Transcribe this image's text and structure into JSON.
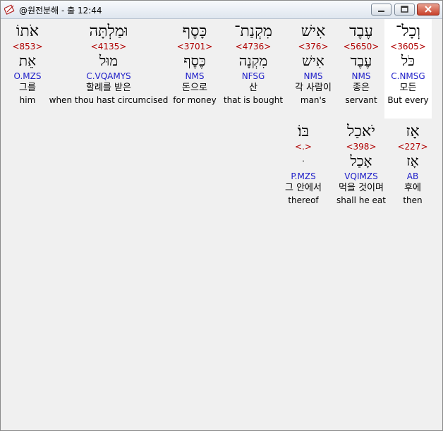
{
  "window": {
    "title": "@원전분해 - 출 12:44",
    "minimize_icon": "minimize-icon",
    "maximize_icon": "maximize-icon",
    "close_icon": "close-icon",
    "app_icon": "app-icon"
  },
  "row1": [
    {
      "hebrew": "וְכָל־",
      "strong": "<3605>",
      "lemma": "כֹּל",
      "morph": "C.NMSG",
      "korean": "모든",
      "english": "But every",
      "selected": true
    },
    {
      "hebrew": "עֶבֶד",
      "strong": "<5650>",
      "lemma": "עֶבֶד",
      "morph": "NMS",
      "korean": "종은",
      "english": "servant"
    },
    {
      "hebrew": "אִישׁ",
      "strong": "<376>",
      "lemma": "אִישׁ",
      "morph": "NMS",
      "korean": "각 사람이",
      "english": "man's"
    },
    {
      "hebrew": "מִקְנַת־",
      "strong": "<4736>",
      "lemma": "מִקְנָה",
      "morph": "NFSG",
      "korean": "산",
      "english": "that is bought"
    },
    {
      "hebrew": "כָּסֶף",
      "strong": "<3701>",
      "lemma": "כֶּסֶף",
      "morph": "NMS",
      "korean": "돈으로",
      "english": "for money"
    },
    {
      "hebrew": "וּמַלְתָּה",
      "strong": "<4135>",
      "lemma": "מוּל",
      "morph": "C.VQAMYS",
      "korean": "할례를 받은",
      "english": "when thou hast circumcised"
    },
    {
      "hebrew": "אֹתוֹ",
      "strong": "<853>",
      "lemma": "אֵת",
      "morph": "O.MZS",
      "korean": "그를",
      "english": "him"
    }
  ],
  "row2": [
    {
      "hebrew": "אָז",
      "strong": "<227>",
      "lemma": "אָז",
      "morph": "AB",
      "korean": "후에",
      "english": "then"
    },
    {
      "hebrew": "יֹאכַל",
      "strong": "<398>",
      "lemma": "אָכַל",
      "morph": "VQIMZS",
      "korean": "먹을 것이며",
      "english": "shall he eat"
    },
    {
      "hebrew": "בּוֹ׃",
      "strong": "<.>",
      "lemma": "ּ",
      "morph": "P.MZS",
      "korean": "그 안에서",
      "english": "thereof"
    }
  ]
}
